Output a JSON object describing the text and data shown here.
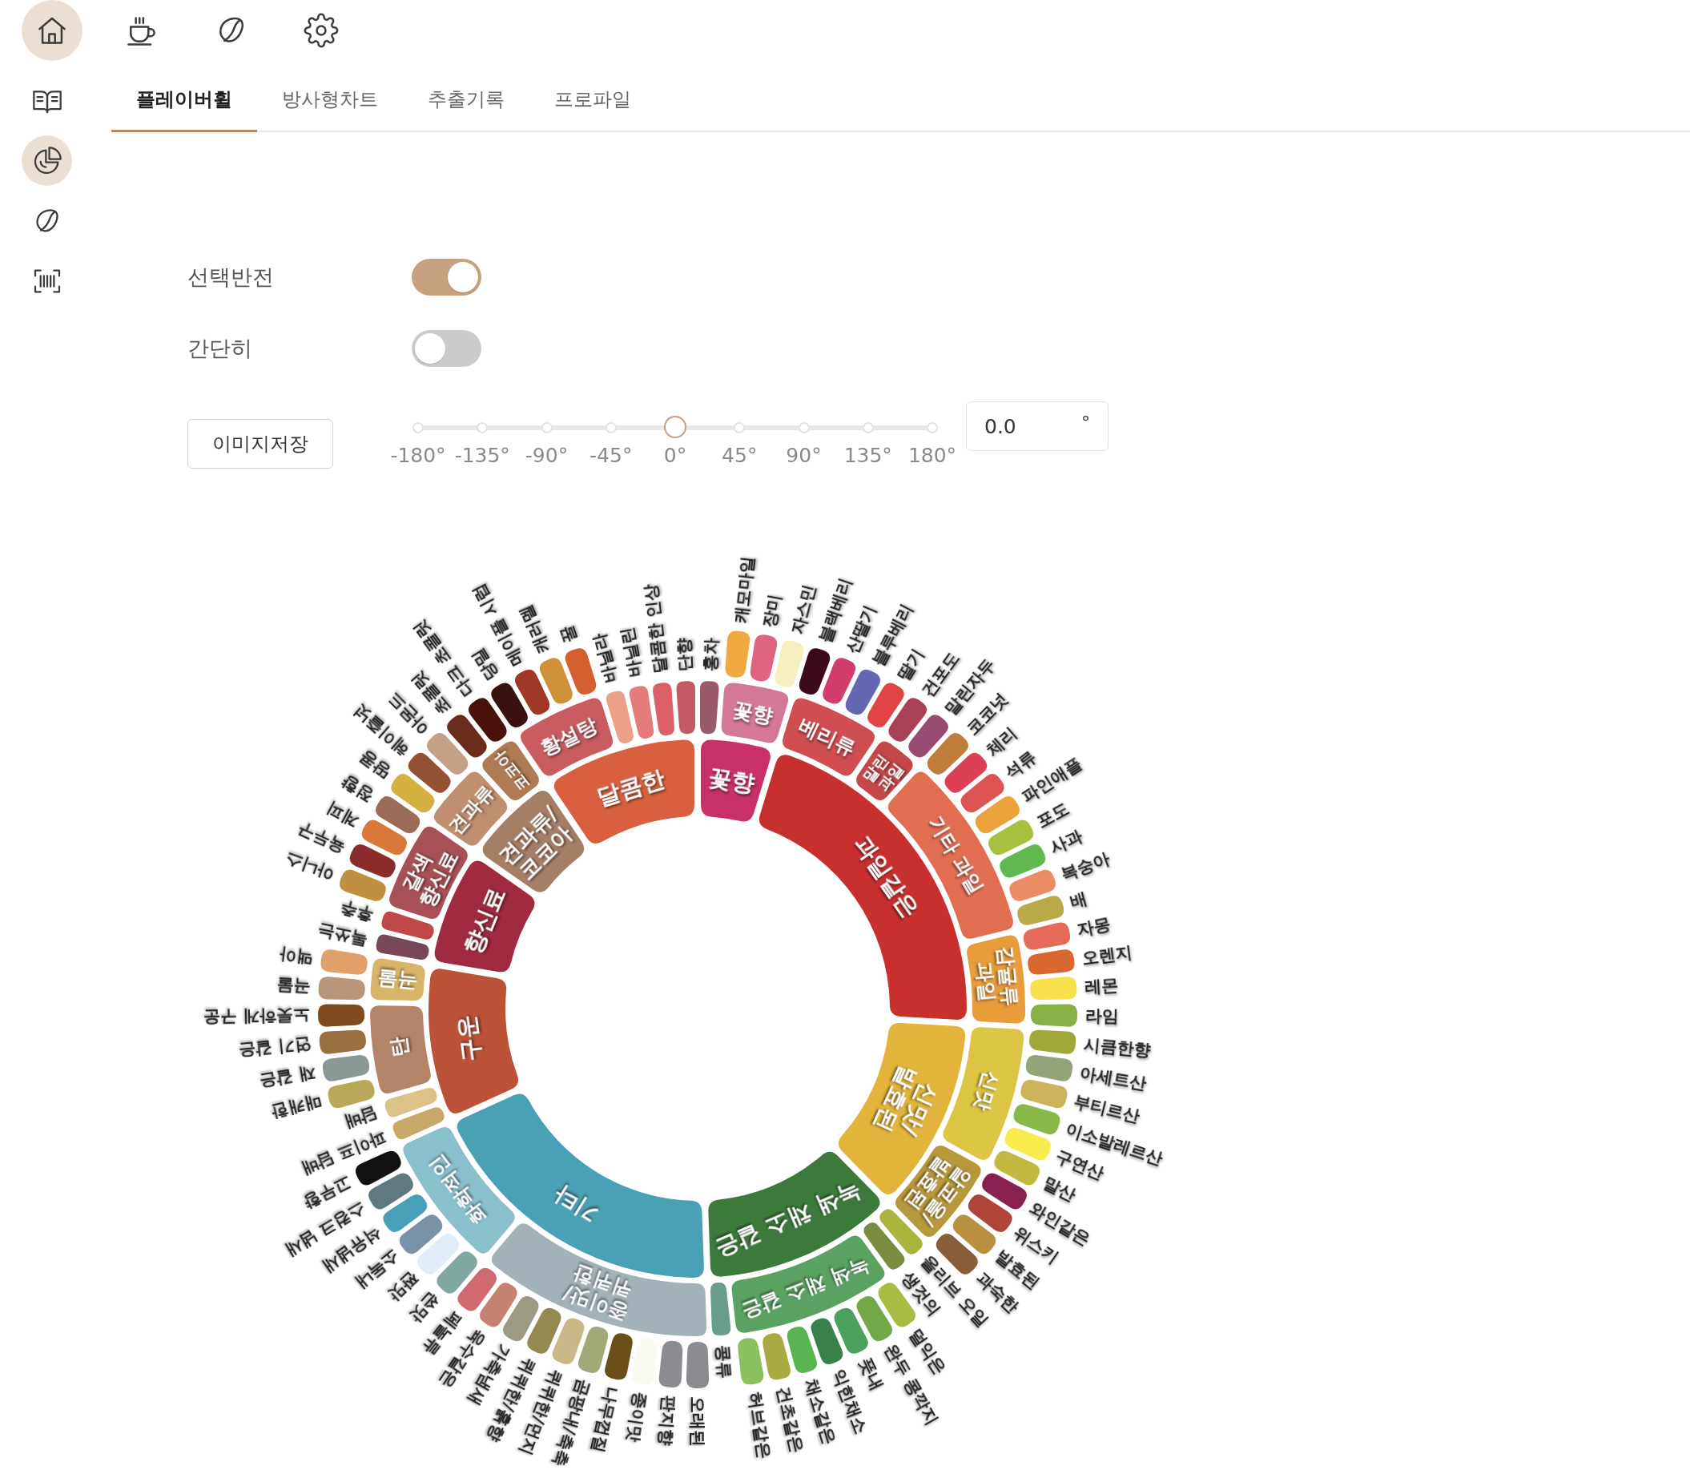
{
  "top_nav": [
    {
      "selected": true
    },
    {
      "selected": false
    },
    {
      "selected": false
    },
    {
      "selected": false
    }
  ],
  "side_nav": [
    {
      "selected": false
    },
    {
      "selected": true
    },
    {
      "selected": false
    },
    {
      "selected": false
    }
  ],
  "tabs": [
    {
      "label": "플레이버휠",
      "selected": true
    },
    {
      "label": "방사형차트",
      "selected": false
    },
    {
      "label": "추출기록",
      "selected": false
    },
    {
      "label": "프로파일",
      "selected": false
    }
  ],
  "settings": {
    "toggles": [
      {
        "label": "선택반전",
        "on": true
      },
      {
        "label": "간단히",
        "on": false
      }
    ],
    "save_button": "이미지저장",
    "rotation": {
      "level": 0.5,
      "marks": [
        "-180°",
        "-135°",
        "-90°",
        "-45°",
        "0°",
        "45°",
        "90°",
        "135°",
        "180°"
      ],
      "value": "0.0",
      "unit": "°"
    }
  },
  "wheel": {
    "categories": [
      {
        "label": "꽃향",
        "color": "#c93068",
        "children": [
          {
            "label": "홍차",
            "color": "#9a5a6c"
          },
          {
            "label": "꽃향",
            "color": "#d47898",
            "children": [
              {
                "label": "캐모마일",
                "color": "#f0a840"
              },
              {
                "label": "장미",
                "color": "#e06482"
              },
              {
                "label": "자스민",
                "color": "#f6f0c0"
              }
            ]
          }
        ]
      },
      {
        "label": "과일같은",
        "color": "#c8302e",
        "children": [
          {
            "label": "베리류",
            "color": "#d04e50",
            "children": [
              {
                "label": "블랙베리",
                "color": "#3c0a1a"
              },
              {
                "label": "산딸기",
                "color": "#d43c6c"
              },
              {
                "label": "블루베리",
                "color": "#6468b0"
              },
              {
                "label": "딸기",
                "color": "#e04444"
              }
            ]
          },
          {
            "label": "말린 과일",
            "color": "#c44848",
            "children": [
              {
                "label": "건포도",
                "color": "#a84058"
              },
              {
                "label": "말린자두",
                "color": "#984c72"
              }
            ]
          },
          {
            "label": "기타 과일",
            "color": "#e26e52",
            "children": [
              {
                "label": "코코넛",
                "color": "#c07c3a"
              },
              {
                "label": "체리",
                "color": "#dc4054"
              },
              {
                "label": "석류",
                "color": "#dc5454"
              },
              {
                "label": "파인애플",
                "color": "#eca23c"
              },
              {
                "label": "포도",
                "color": "#a8c040"
              },
              {
                "label": "사과",
                "color": "#62b850"
              },
              {
                "label": "복숭아",
                "color": "#ea8c64"
              },
              {
                "label": "배",
                "color": "#b8aa48"
              }
            ]
          },
          {
            "label": "감귤류 과일",
            "color": "#e99c3a",
            "children": [
              {
                "label": "자몽",
                "color": "#e46a5a"
              },
              {
                "label": "오렌지",
                "color": "#d86830"
              },
              {
                "label": "레몬",
                "color": "#f8e04a"
              },
              {
                "label": "라임",
                "color": "#88b048"
              }
            ]
          }
        ]
      },
      {
        "label": "신맛/발효된",
        "color": "#e2b43c",
        "children": [
          {
            "label": "신맛",
            "color": "#dcc444",
            "children": [
              {
                "label": "시큼한향",
                "color": "#a0a838"
              },
              {
                "label": "아세트산",
                "color": "#94a47a"
              },
              {
                "label": "부티르산",
                "color": "#ccb45c"
              },
              {
                "label": "이소발레르산",
                "color": "#88b848"
              },
              {
                "label": "구연산",
                "color": "#f8ec4c"
              },
              {
                "label": "말산",
                "color": "#c2ba40"
              }
            ]
          },
          {
            "label": "알코올/발효된",
            "color": "#b8983c",
            "children": [
              {
                "label": "와인같은",
                "color": "#882050"
              },
              {
                "label": "위스키",
                "color": "#b04438"
              },
              {
                "label": "발효된",
                "color": "#b89040"
              },
              {
                "label": "과숙한",
                "color": "#885e38"
              }
            ]
          }
        ]
      },
      {
        "label": "녹색 채소 같은",
        "color": "#3c7a3c",
        "children": [
          {
            "label": "올리브 오일",
            "color": "#a9b53e"
          },
          {
            "label": "생것의",
            "color": "#7a8c3e"
          },
          {
            "label": "녹색 채소 같은",
            "color": "#5aa262",
            "children": [
              {
                "label": "덜익은",
                "color": "#a8bc42"
              },
              {
                "label": "완두 콩깍지",
                "color": "#72a848"
              },
              {
                "label": "풋내",
                "color": "#4aa05c"
              },
              {
                "label": "익힌채소",
                "color": "#3a804a"
              },
              {
                "label": "채소같은",
                "color": "#5ab452"
              },
              {
                "label": "건초같은",
                "color": "#a8aa42"
              },
              {
                "label": "허브같은",
                "color": "#8cc05c"
              }
            ]
          },
          {
            "label": "콩류",
            "color": "#6a9c8c"
          }
        ]
      },
      {
        "label": "기타",
        "color": "#4aa0b4",
        "children": [
          {
            "label": "종이맛/퀴퀴한",
            "color": "#a2b2b8",
            "children": [
              {
                "label": "오래된",
                "color": "#8a8c90"
              },
              {
                "label": "판지향",
                "color": "#8a8c90"
              },
              {
                "label": "종이맛",
                "color": "#fbfaf0"
              },
              {
                "label": "나무껍질",
                "color": "#6a5018"
              },
              {
                "label": "곰팡내/축축",
                "color": "#a2a878"
              },
              {
                "label": "퀴퀴한/먼지",
                "color": "#c8b888"
              },
              {
                "label": "퀴퀴한/흙향",
                "color": "#948a50"
              },
              {
                "label": "가축냄새",
                "color": "#9c9a82"
              },
              {
                "label": "육수같은",
                "color": "#c88272"
              },
              {
                "label": "페놀류",
                "color": "#d06a70"
              }
            ]
          },
          {
            "label": "화학적인",
            "color": "#88c0cc",
            "children": [
              {
                "label": "쓴맛",
                "color": "#80a8a0"
              },
              {
                "label": "짠맛",
                "color": "#e0ecf8"
              },
              {
                "label": "소독내",
                "color": "#7a92a8"
              },
              {
                "label": "석유냄새",
                "color": "#48a0b8"
              },
              {
                "label": "스컹크 냄새",
                "color": "#607880"
              },
              {
                "label": "고무향",
                "color": "#121010"
              }
            ]
          }
        ]
      },
      {
        "label": "구운",
        "color": "#bc5238",
        "children": [
          {
            "label": "파이프 담배",
            "color": "#c8a868"
          },
          {
            "label": "담배",
            "color": "#dcc288"
          },
          {
            "label": "탄",
            "color": "#b48468",
            "children": [
              {
                "label": "매캐한",
                "color": "#b8a858"
              },
              {
                "label": "재 같은",
                "color": "#8c9896"
              },
              {
                "label": "연기 같은",
                "color": "#9a7040"
              },
              {
                "label": "노릇하게 구운",
                "color": "#7e4a1e"
              }
            ]
          },
          {
            "label": "곡물",
            "color": "#d8b468",
            "children": [
              {
                "label": "곡물",
                "color": "#b8967a"
              },
              {
                "label": "맥아",
                "color": "#e0a068"
              }
            ]
          }
        ]
      },
      {
        "label": "향신료",
        "color": "#a02a40",
        "children": [
          {
            "label": "톡쏘는",
            "color": "#784858"
          },
          {
            "label": "후추",
            "color": "#c04848"
          },
          {
            "label": "갈색 향신료",
            "color": "#a85058",
            "children": [
              {
                "label": "아니스",
                "color": "#c09040"
              },
              {
                "label": "육두구",
                "color": "#8a2c2c"
              },
              {
                "label": "계피",
                "color": "#d87838"
              },
              {
                "label": "정향",
                "color": "#9c6c5a"
              }
            ]
          }
        ]
      },
      {
        "label": "견과류/코코아",
        "color": "#a57e66",
        "children": [
          {
            "label": "견과류",
            "color": "#c08e70",
            "children": [
              {
                "label": "땅콩",
                "color": "#d4b040"
              },
              {
                "label": "헤이즐넛",
                "color": "#945032"
              },
              {
                "label": "아몬드",
                "color": "#c4a088"
              }
            ]
          },
          {
            "label": "코코아",
            "color": "#b07a52",
            "children": [
              {
                "label": "초콜릿",
                "color": "#6a2c1c"
              },
              {
                "label": "다크 초콜릿",
                "color": "#4a100a"
              }
            ]
          }
        ]
      },
      {
        "label": "달콤한",
        "color": "#d9603e",
        "children": [
          {
            "label": "황설탕",
            "color": "#c85c60",
            "children": [
              {
                "label": "당밀",
                "color": "#3a1010"
              },
              {
                "label": "메이플 시럽",
                "color": "#a03828"
              },
              {
                "label": "캐러멜",
                "color": "#d09038"
              },
              {
                "label": "꿀",
                "color": "#d46030"
              }
            ]
          },
          {
            "label": "바닐라",
            "color": "#eca088"
          },
          {
            "label": "바닐린",
            "color": "#e47c7c"
          },
          {
            "label": "달콤한 인상",
            "color": "#dc6068"
          },
          {
            "label": "단향",
            "color": "#c45a66"
          }
        ]
      }
    ]
  }
}
